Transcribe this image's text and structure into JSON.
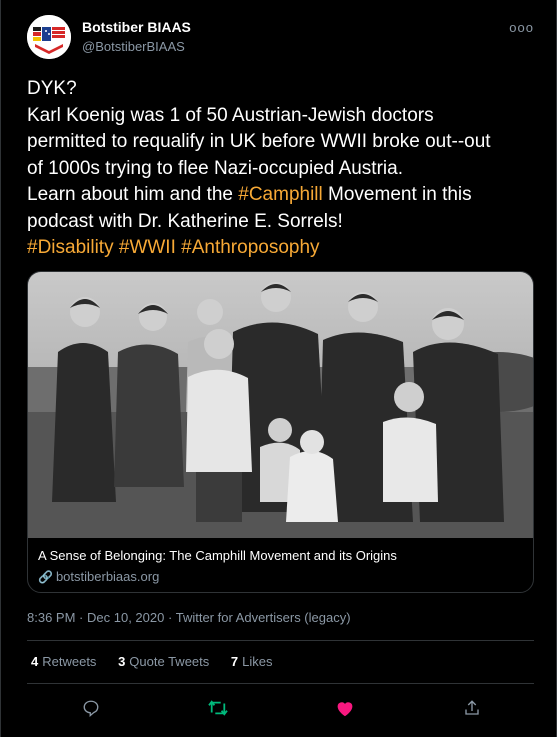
{
  "user": {
    "name": "Botstiber BIAAS",
    "handle": "@BotstiberBIAAS",
    "more": "ooo"
  },
  "tweet": {
    "line1": "DYK?",
    "line2": "Karl Koenig was 1 of 50 Austrian-Jewish doctors",
    "line3": "permitted to requalify in UK before WWII broke out--out",
    "line4": "of 1000s trying to flee Nazi-occupied Austria.",
    "line5_pre": "Learn about him and the ",
    "line5_hash": "#Camphill",
    "line5_post": " Movement in this",
    "line6": "podcast with Dr. Katherine E. Sorrels!",
    "hashtags": [
      "#Disability",
      "#WWII",
      "#Anthroposophy"
    ]
  },
  "card": {
    "title": "A Sense of Belonging: The Camphill Movement and its Origins",
    "domain": "botstiberbiaas.org",
    "link_icon": "🔗"
  },
  "meta": {
    "time": "8:36 PM",
    "date": "Dec 10, 2020",
    "source": "Twitter for Advertisers (legacy)",
    "dot": "·"
  },
  "stats": {
    "retweets_count": "4",
    "retweets_label": "Retweets",
    "quotes_count": "3",
    "quotes_label": "Quote Tweets",
    "likes_count": "7",
    "likes_label": "Likes"
  },
  "colors": {
    "hashtag": "#f7a936",
    "retweet_active": "#00ba7c",
    "like_active": "#f91880",
    "secondary": "#8b98a5"
  },
  "icons": [
    "reply-icon",
    "retweet-icon",
    "like-icon",
    "share-icon",
    "link-icon",
    "more-icon"
  ]
}
